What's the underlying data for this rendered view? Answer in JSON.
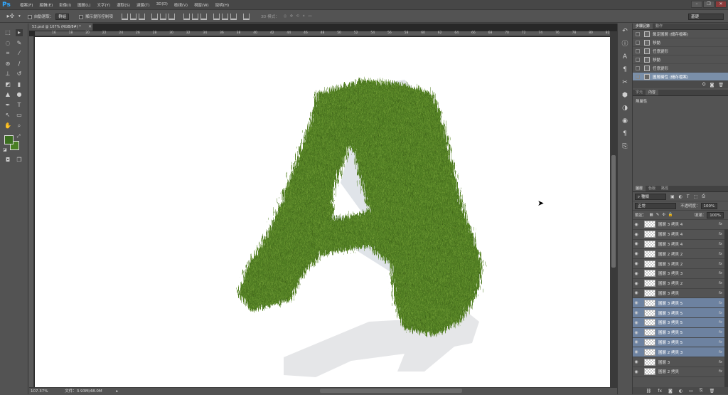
{
  "app": {
    "logo": "Ps"
  },
  "menu": [
    "檔案(F)",
    "編輯(E)",
    "影像(I)",
    "圖層(L)",
    "文字(Y)",
    "選取(S)",
    "濾鏡(T)",
    "3D(D)",
    "檢視(V)",
    "視窗(W)",
    "說明(H)"
  ],
  "window_controls": [
    "–",
    "❐",
    "✕"
  ],
  "options": {
    "auto_select_label": "自動選取：",
    "auto_select_value": "群組",
    "show_transform_label": "顯示變形控制項",
    "mode_3d_label": "3D 模式：",
    "workspace": "基礎"
  },
  "document": {
    "tab_title": "53.psd @ 107% (RGB/8#) *",
    "zoom": "107.37%",
    "file_info": "文件：3.93M/48.0M",
    "letter": "A"
  },
  "ruler_ticks": [
    "16",
    "18",
    "20",
    "22",
    "24",
    "26",
    "28",
    "30",
    "32",
    "34",
    "36",
    "38",
    "40",
    "42",
    "44",
    "46",
    "48",
    "50",
    "52",
    "54",
    "56",
    "58",
    "60",
    "62",
    "64",
    "66",
    "68",
    "70",
    "72",
    "74",
    "76",
    "78",
    "80",
    "82"
  ],
  "history_panel": {
    "tabs": [
      "步驟記錄",
      "動作"
    ],
    "items": [
      {
        "label": "鎖定圖層 (儲存檔案)",
        "icon": "lock-icon",
        "selected": false
      },
      {
        "label": "移動",
        "icon": "move-icon",
        "selected": false
      },
      {
        "label": "任意變形",
        "icon": "transform-icon",
        "selected": false
      },
      {
        "label": "移動",
        "icon": "move-icon",
        "selected": false
      },
      {
        "label": "任意變形",
        "icon": "transform-icon",
        "selected": false
      },
      {
        "label": "圖層屬性 (儲存檔案)",
        "icon": "layer-icon",
        "selected": true
      }
    ]
  },
  "properties_panel": {
    "tabs": [
      "字元",
      "內容"
    ],
    "content": "無屬性"
  },
  "layers_panel": {
    "tabs": [
      "圖層",
      "色版",
      "路徑"
    ],
    "filter": "種類",
    "blend_mode": "正常",
    "opacity_label": "不透明度：",
    "opacity_value": "100%",
    "lock_label": "鎖定：",
    "fill_label": "填滿：",
    "fill_value": "100%",
    "layers": [
      {
        "name": "圖層 3 拷貝 4",
        "selected": false
      },
      {
        "name": "圖層 3 拷貝 4",
        "selected": false
      },
      {
        "name": "圖層 3 拷貝 4",
        "selected": false
      },
      {
        "name": "圖層 2 拷貝 2",
        "selected": false
      },
      {
        "name": "圖層 3 拷貝 2",
        "selected": false
      },
      {
        "name": "圖層 3 拷貝 3",
        "selected": false
      },
      {
        "name": "圖層 3 拷貝 2",
        "selected": false
      },
      {
        "name": "圖層 3 拷貝",
        "selected": false
      },
      {
        "name": "圖層 3 拷貝 5",
        "selected": true
      },
      {
        "name": "圖層 3 拷貝 5",
        "selected": true
      },
      {
        "name": "圖層 3 拷貝 5",
        "selected": true
      },
      {
        "name": "圖層 3 拷貝 5",
        "selected": true
      },
      {
        "name": "圖層 3 拷貝 5",
        "selected": true
      },
      {
        "name": "圖層 2 拷貝 3",
        "selected": true
      },
      {
        "name": "圖層 3",
        "selected": false
      },
      {
        "name": "圖層 2 拷貝",
        "selected": false
      }
    ]
  },
  "colors": {
    "foreground": "#3b6e1f",
    "background": "#4a7f24",
    "selection": "#6d82a0",
    "grass": "#4f7c22"
  }
}
